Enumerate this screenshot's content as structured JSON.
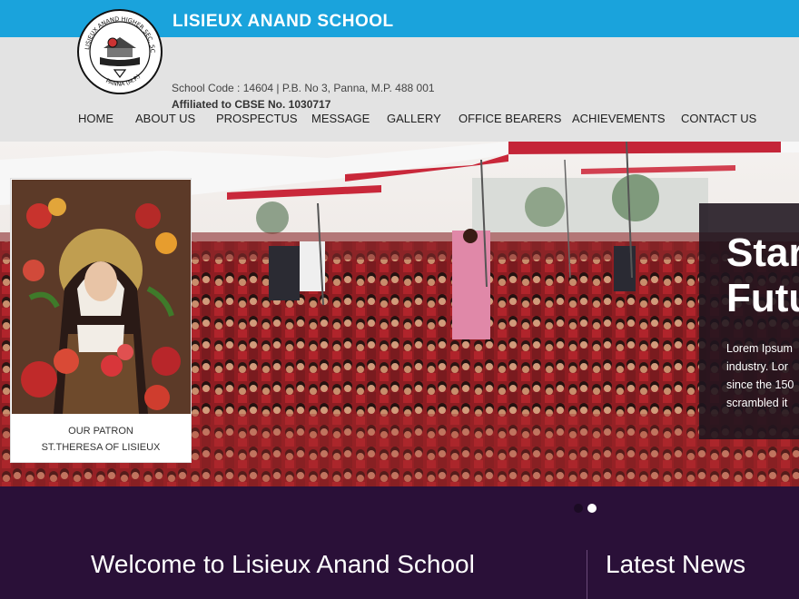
{
  "header": {
    "school_name": "LISIEUX ANAND SCHOOL",
    "info_line1": "School Code : 14604  | P.B. No 3, Panna, M.P. 488 001",
    "info_line2": "Affiliated to CBSE No. 1030717",
    "logo_text_top": "LISIEUX ANAND HIGHER SEC. SCHOOL",
    "logo_text_bottom": "PANNA (M.P.)"
  },
  "nav": {
    "items": [
      "HOME",
      "ABOUT US",
      "PROSPECTUS",
      "MESSAGE",
      "GALLERY",
      "OFFICE BEARERS",
      "ACHIEVEMENTS",
      "CONTACT US"
    ]
  },
  "patron": {
    "caption_line1": "OUR PATRON",
    "caption_line2": "ST.THERESA OF LISIEUX"
  },
  "slider": {
    "title": "Star\nFutu",
    "text": "Lorem Ipsum\nindustry. Lor\nsince the 150\nscrambled it",
    "active_dot": 1
  },
  "sections": {
    "welcome": "Welcome to Lisieux Anand School",
    "news": "Latest News"
  },
  "colors": {
    "topbar": "#1aa3dc",
    "header_bg": "#e3e3e3",
    "footer_bg": "#2a1038"
  }
}
